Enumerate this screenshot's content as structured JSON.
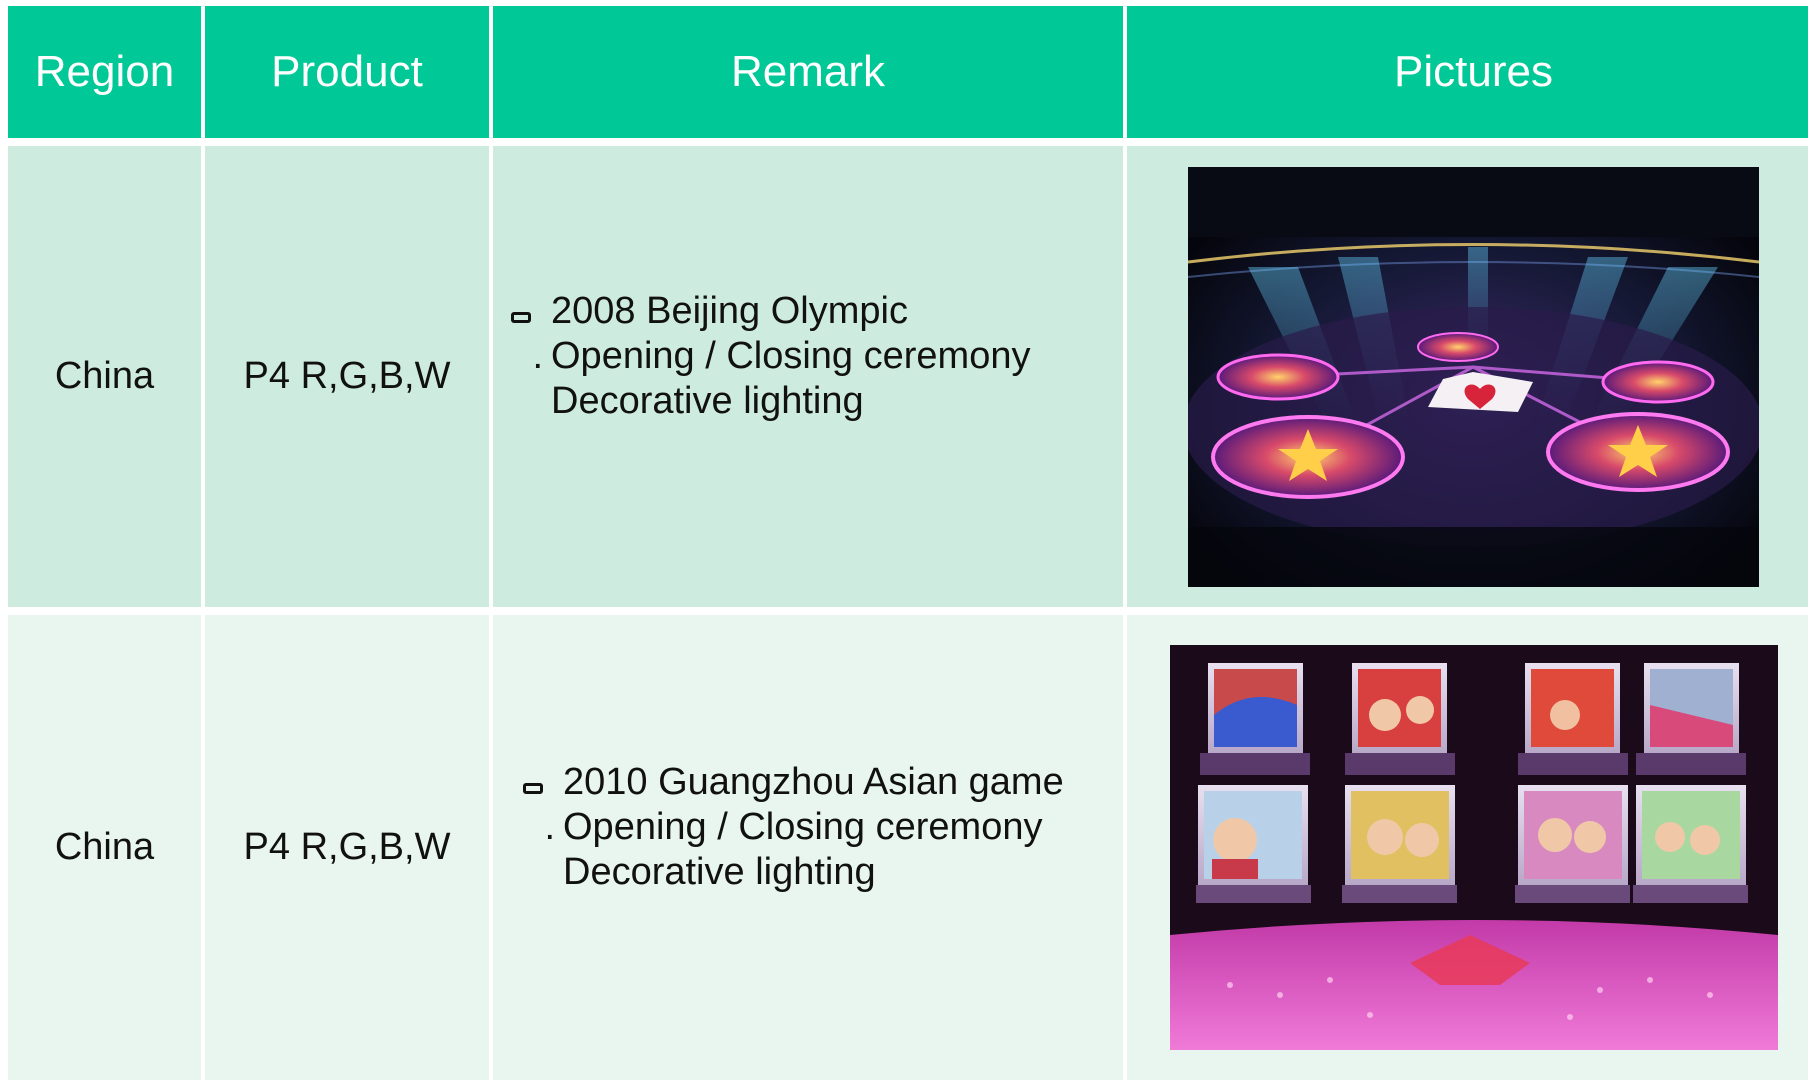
{
  "header": {
    "region": "Region",
    "product": "Product",
    "remark": "Remark",
    "pictures": "Pictures"
  },
  "rows": [
    {
      "region": "China",
      "product": "P4 R,G,B,W",
      "remark_title": "2008 Beijing Olympic",
      "remark_line2": "Opening / Closing ceremony",
      "remark_line3": "Decorative lighting",
      "bullet_sub": "."
    },
    {
      "region": "China",
      "product": "P4 R,G,B,W",
      "remark_title": "2010 Guangzhou Asian game",
      "remark_line2": "Opening / Closing ceremony",
      "remark_line3": "Decorative lighting",
      "bullet_sub": "."
    }
  ],
  "colors": {
    "header_bg": "#00c896",
    "row1_bg": "#ceebdf",
    "row2_bg": "#e8f6ef"
  },
  "icons": [
    "square-bullet-icon",
    "dot-bullet-icon"
  ]
}
